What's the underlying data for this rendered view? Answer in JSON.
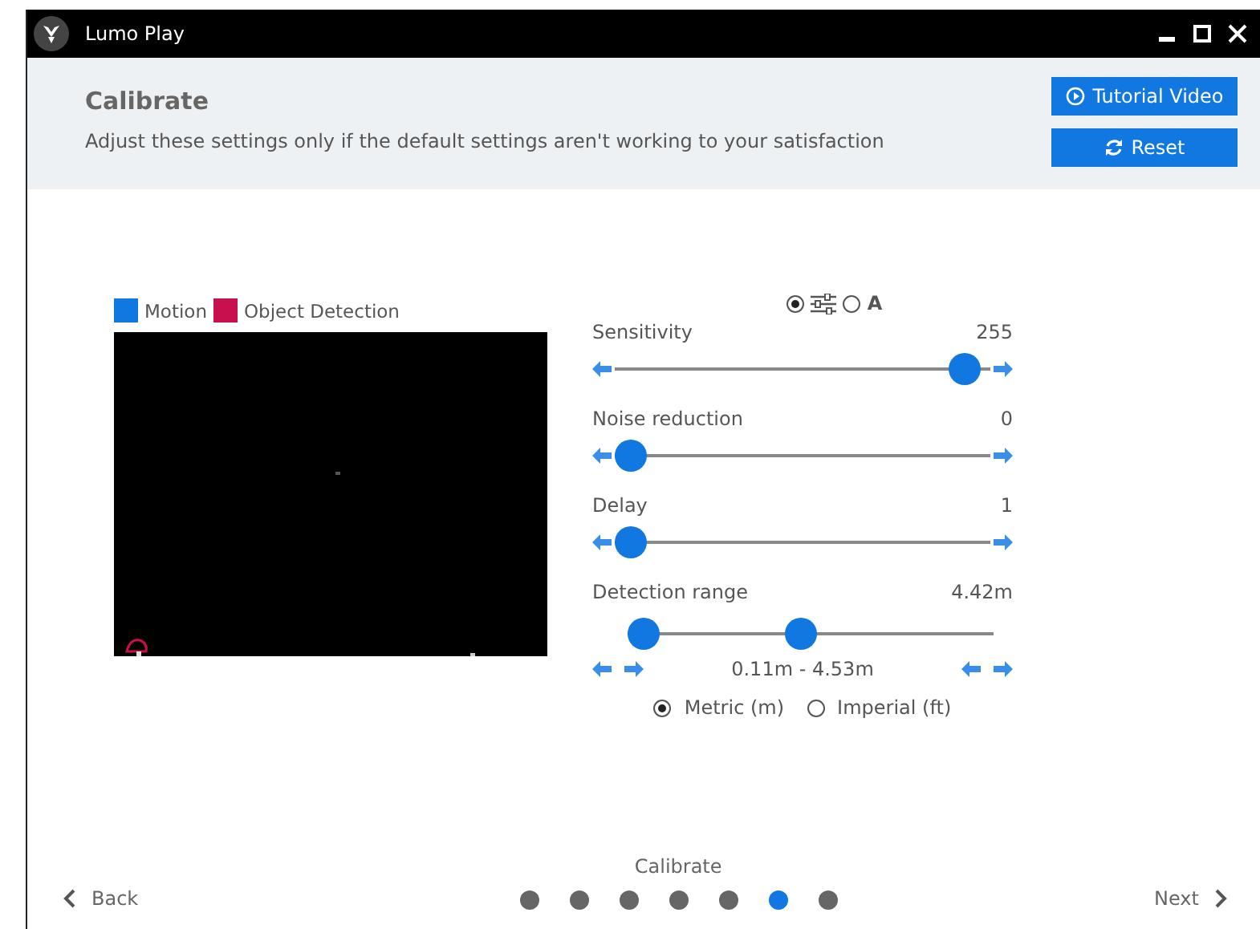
{
  "window": {
    "title": "Lumo Play"
  },
  "header": {
    "title": "Calibrate",
    "subtitle": "Adjust these settings only if the default settings aren't working to your satisfaction",
    "buttons": [
      {
        "kind": "play",
        "label": "Tutorial Video"
      },
      {
        "kind": "reset",
        "label": "Reset"
      }
    ]
  },
  "legend": [
    {
      "label": "Motion",
      "color": "#1078e0"
    },
    {
      "label": "Object Detection",
      "color": "#c8104f"
    }
  ],
  "mode": [
    {
      "kind": "sliders",
      "selected": true
    },
    {
      "kind": "text",
      "label": "A",
      "selected": false
    }
  ],
  "sliders": [
    {
      "label": "Sensitivity",
      "value": "255",
      "level": 0.97
    },
    {
      "label": "Noise reduction",
      "value": "0",
      "level": 0
    },
    {
      "label": "Delay",
      "value": "1",
      "level": 0
    }
  ],
  "range": {
    "label": "Detection range",
    "value": "4.42m",
    "low": {
      "level": 0
    },
    "high": {
      "level": 0.47
    },
    "reading": "0.11m - 4.53m"
  },
  "units": [
    {
      "label": "Metric (m)",
      "selected": true
    },
    {
      "label": "Imperial (ft)",
      "selected": false
    }
  ],
  "footer": {
    "step": "Calibrate",
    "back": "Back",
    "next": "Next",
    "steps": [
      {
        "selected": false
      },
      {
        "selected": false
      },
      {
        "selected": false
      },
      {
        "selected": false
      },
      {
        "selected": false
      },
      {
        "selected": true
      },
      {
        "selected": false
      }
    ]
  }
}
